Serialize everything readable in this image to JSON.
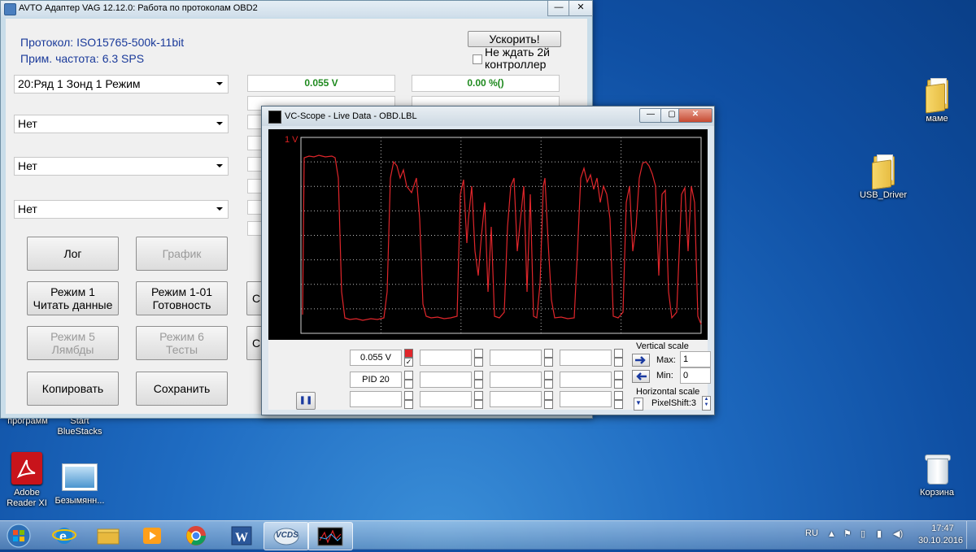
{
  "desktop": {
    "icons": {
      "mame": "маме",
      "usb_driver": "USB_Driver",
      "korzina": "Корзина",
      "adobe": "Adobe Reader XI",
      "bezymyanny": "Безымянн...",
      "bluestacks_partial": "Start BlueStacks",
      "programs_partial": "программ"
    }
  },
  "main_window": {
    "title": "AVTO Адаптер VAG 12.12.0:  Работа по протоколам OBD2",
    "protocol": "Протокол: ISO15765-500k-11bit",
    "rate": "Прим. частота: 6.3 SPS",
    "speed_button": "Ускорить!",
    "no_wait_label_1": "Не ждать 2й",
    "no_wait_label_2": "контроллер",
    "selectors": [
      "20:Ряд 1 Зонд 1 Режим",
      "Нет",
      "Нет",
      "Нет"
    ],
    "value_1": "0.055 V",
    "value_2": "0.00 %()",
    "buttons": {
      "log": "Лог",
      "graph": "График",
      "mode1_line1": "Режим 1",
      "mode1_line2": "Читать данные",
      "mode101_line1": "Режим 1-01",
      "mode101_line2": "Готовность",
      "mode5_line1": "Режим 5",
      "mode5_line2": "Лямбды",
      "mode6_line1": "Режим 6",
      "mode6_line2": "Тесты",
      "copy": "Копировать",
      "save": "Сохранить",
      "partial_c1": "С",
      "partial_c2": "С"
    }
  },
  "scope_window": {
    "title": "VC-Scope  -  Live Data  -  OBD.LBL",
    "y_label": "1 V",
    "trace_color": "#e0262b",
    "channel_value": "0.055 V",
    "channel_pid": "PID 20",
    "vertical_scale": "Vertical scale",
    "max_label": "Max:",
    "max_value": "1",
    "min_label": "Min:",
    "min_value": "0",
    "horizontal_scale": "Horizontal scale",
    "pixelshift": "PixelShift:3",
    "pause_icon": "pause-icon"
  },
  "taskbar": {
    "lang": "RU",
    "time": "17:47",
    "date": "30.10.2016",
    "vcds_label": "VCDS"
  }
}
